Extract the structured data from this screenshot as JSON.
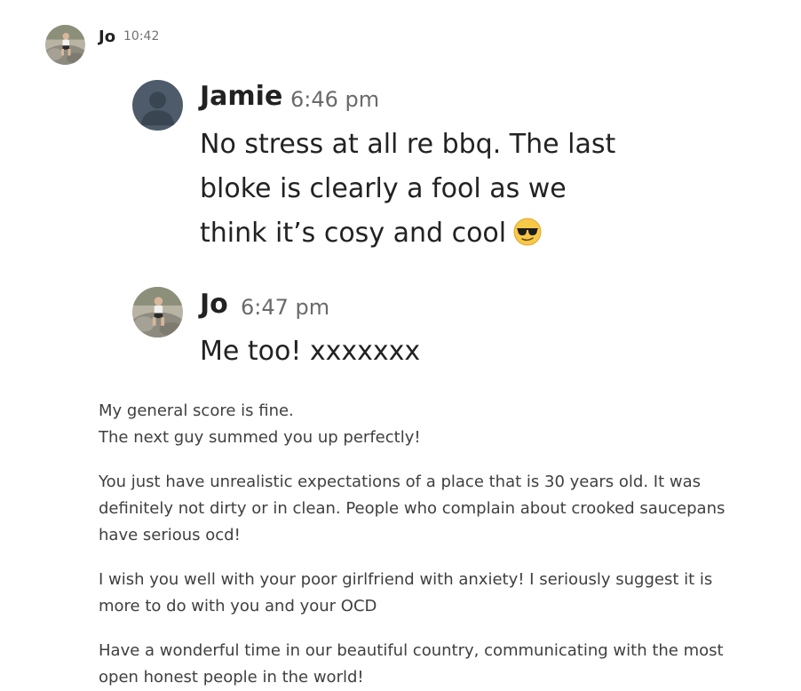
{
  "outer_message": {
    "sender": "Jo",
    "time": "10:42",
    "avatar": "photo-avatar-icon"
  },
  "quoted_screenshot": {
    "messages": [
      {
        "sender": "Jamie",
        "time": "6:46 pm",
        "avatar": "default-person-avatar-icon",
        "lines": [
          "No stress at all re bbq. The last",
          "bloke is clearly a fool as we",
          "think it’s cosy and cool"
        ],
        "emoji": "sunglasses-emoji-icon"
      },
      {
        "sender": "Jo",
        "time": "6:47 pm",
        "avatar": "photo-avatar-icon",
        "lines": [
          "Me too! xxxxxxx"
        ]
      }
    ]
  },
  "body_paragraphs": [
    [
      "My general score is fine.",
      "The next guy summed you up perfectly!"
    ],
    [
      "You just have unrealistic expectations of a place that is 30 years old. It was",
      "definitely not dirty or in clean. People who complain about crooked saucepans",
      "have serious ocd!"
    ],
    [
      "I wish you well with your poor girlfriend with anxiety! I seriously suggest it is",
      "more to do with you and your OCD"
    ],
    [
      "Have a wonderful time in our beautiful country, communicating with the most",
      "open honest people in the world!"
    ]
  ],
  "colors": {
    "primary_text": "#222222",
    "body_text": "#3f3f3f",
    "timestamp": "#717171",
    "default_avatar": "#4d5b6a"
  }
}
